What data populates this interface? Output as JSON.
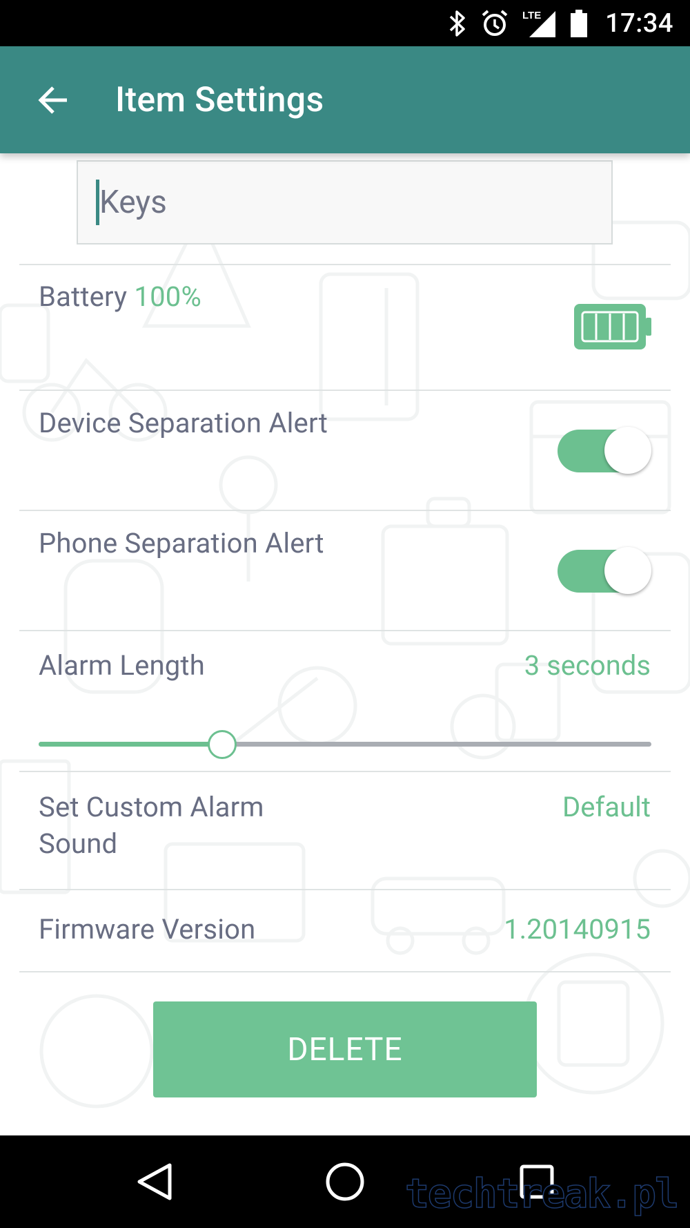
{
  "status_bar": {
    "time": "17:34",
    "network": "LTE",
    "icons": [
      "bluetooth-icon",
      "alarm-clock-icon",
      "lte-signal-icon",
      "battery-status-icon"
    ]
  },
  "app_bar": {
    "title": "Item Settings",
    "back_icon": "arrow-back-icon",
    "background": "#3a8984"
  },
  "name_field": {
    "value": "Keys"
  },
  "battery": {
    "label": "Battery",
    "level": "100%",
    "icon": "battery-full-icon"
  },
  "device_separation_alert": {
    "label": "Device Separation Alert",
    "enabled": true
  },
  "phone_separation_alert": {
    "label": "Phone Separation Alert",
    "enabled": true
  },
  "alarm_length": {
    "label": "Alarm Length",
    "value_text": "3 seconds",
    "slider_fraction": 0.3
  },
  "custom_alarm_sound": {
    "label_line1": "Set Custom Alarm",
    "label_line2": "Sound",
    "value": "Default"
  },
  "firmware": {
    "label": "Firmware Version",
    "value": "1.20140915"
  },
  "delete_button": {
    "label": "DELETE"
  },
  "nav_bar": {
    "icons": [
      "nav-back-icon",
      "nav-home-icon",
      "nav-recents-icon"
    ]
  },
  "watermark": "techtreak.pl",
  "colors": {
    "accent": "#6cc090",
    "primary": "#3a8984",
    "label_text": "#686d82"
  }
}
